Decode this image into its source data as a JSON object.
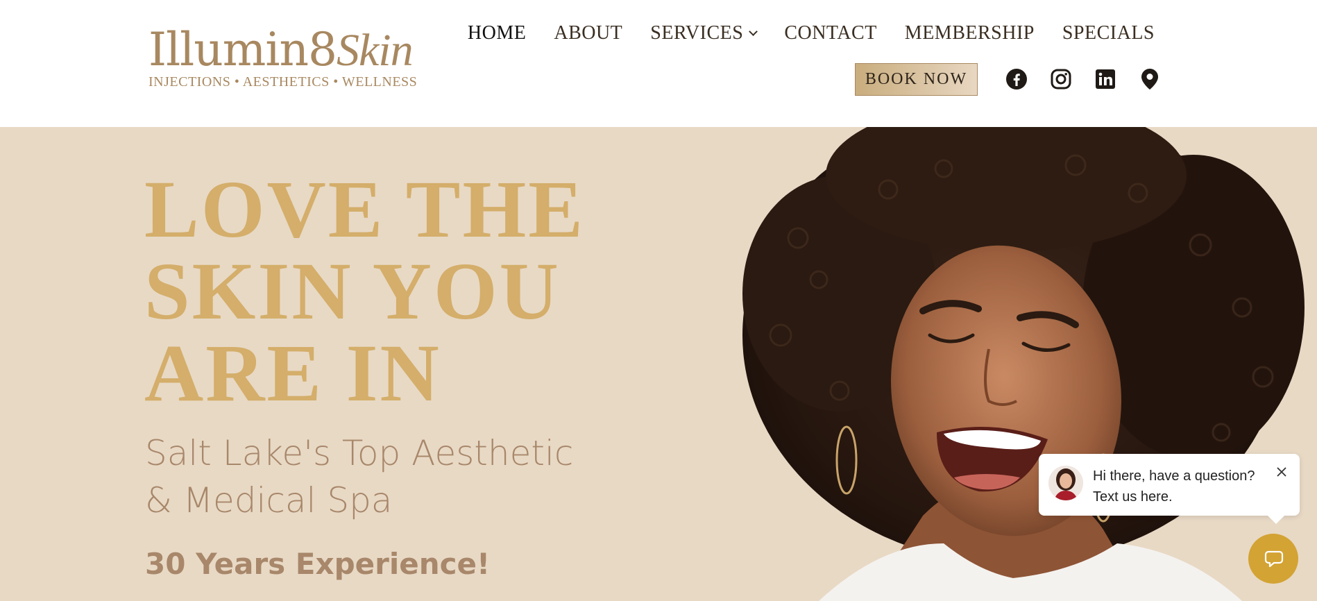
{
  "header": {
    "logo": {
      "name_part1": "Illumin8",
      "name_part2": "Skin",
      "tagline": "INJECTIONS • AESTHETICS • WELLNESS"
    },
    "nav": [
      {
        "label": "HOME"
      },
      {
        "label": "ABOUT"
      },
      {
        "label": "SERVICES"
      },
      {
        "label": "CONTACT"
      },
      {
        "label": "MEMBERSHIP"
      },
      {
        "label": "SPECIALS"
      }
    ],
    "book_label": "BOOK NOW",
    "social_icons": [
      "facebook-icon",
      "instagram-icon",
      "linkedin-icon",
      "map-pin-icon"
    ]
  },
  "hero": {
    "title_lines": [
      "LOVE THE",
      "SKIN YOU",
      "ARE IN"
    ],
    "subtitle_lines": [
      "Salt Lake's Top Aesthetic",
      "& Medical Spa"
    ],
    "experience": "30 Years Experience!"
  },
  "chat": {
    "message_lines": [
      "Hi there, have a question?",
      "Text us here."
    ]
  },
  "colors": {
    "hero_bg": "#e8d9c5",
    "gold_title": "#d4ae6a",
    "subtitle": "#a8876a",
    "chat_fab": "#d3a333",
    "nav_text": "#3a2e22"
  }
}
